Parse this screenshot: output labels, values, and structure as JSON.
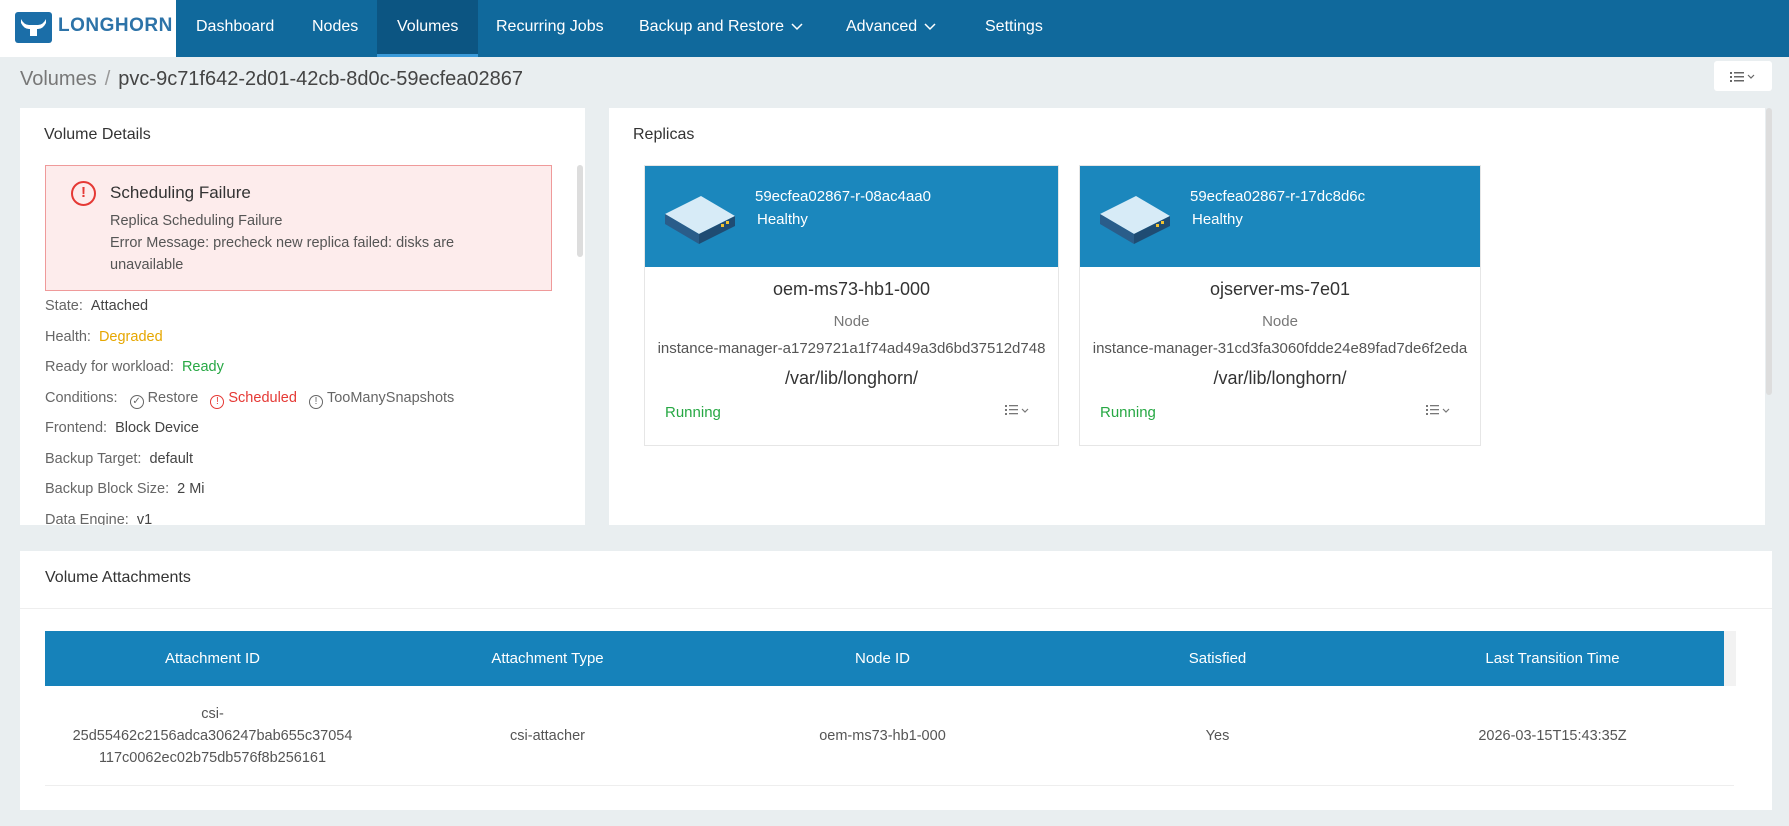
{
  "nav": {
    "logo": "LONGHORN",
    "items": [
      {
        "label": "Dashboard"
      },
      {
        "label": "Nodes"
      },
      {
        "label": "Volumes"
      },
      {
        "label": "Recurring Jobs"
      },
      {
        "label": "Backup and Restore"
      },
      {
        "label": "Advanced"
      },
      {
        "label": "Settings"
      }
    ],
    "active": "Volumes"
  },
  "breadcrumb": {
    "parent": "Volumes",
    "separator": "/",
    "current": "pvc-9c71f642-2d01-42cb-8d0c-59ecfea02867"
  },
  "volume_details": {
    "title": "Volume Details",
    "alert": {
      "title": "Scheduling Failure",
      "line1": "Replica Scheduling Failure",
      "line2": "Error Message: precheck new replica failed: disks are unavailable",
      "icon": "alert-circle-icon"
    },
    "state_label": "State:",
    "state": "Attached",
    "health_label": "Health:",
    "health": "Degraded",
    "ready_label": "Ready for workload:",
    "ready": "Ready",
    "conditions_label": "Conditions:",
    "conditions": [
      "Restore",
      "Scheduled",
      "TooManySnapshots"
    ],
    "frontend_label": "Frontend:",
    "frontend": "Block Device",
    "backup_target_label": "Backup Target:",
    "backup_target": "default",
    "backup_block_label": "Backup Block Size:",
    "backup_block": "2 Mi",
    "data_engine_label": "Data Engine:",
    "data_engine": "v1"
  },
  "replicas": {
    "title": "Replicas",
    "node_label": "Node",
    "items": [
      {
        "name": "59ecfea02867-r-08ac4aa0",
        "status": "Healthy",
        "node": "oem-ms73-hb1-000",
        "instance_manager": "instance-manager-a1729721a1f74ad49a3d6bd37512d748",
        "path": "/var/lib/longhorn/",
        "state": "Running"
      },
      {
        "name": "59ecfea02867-r-17dc8d6c",
        "status": "Healthy",
        "node": "ojserver-ms-7e01",
        "instance_manager": "instance-manager-31cd3fa3060fdde24e89fad7de6f2eda",
        "path": "/var/lib/longhorn/",
        "state": "Running"
      }
    ]
  },
  "attachments": {
    "title": "Volume Attachments",
    "columns": [
      "Attachment ID",
      "Attachment Type",
      "Node ID",
      "Satisfied",
      "Last Transition Time"
    ],
    "rows": [
      {
        "id_line1": "csi-",
        "id_line2": "25d55462c2156adca306247bab655c37054",
        "id_line3": "117c0062ec02b75db576f8b256161",
        "type": "csi-attacher",
        "node": "oem-ms73-hb1-000",
        "satisfied": "Yes",
        "time": "2026-03-15T15:43:35Z"
      }
    ]
  },
  "colors": {
    "nav_bg": "#10699c",
    "header_blue": "#1b87bd",
    "warning": "#e6a700",
    "success": "#27a844",
    "error": "#e53935"
  }
}
